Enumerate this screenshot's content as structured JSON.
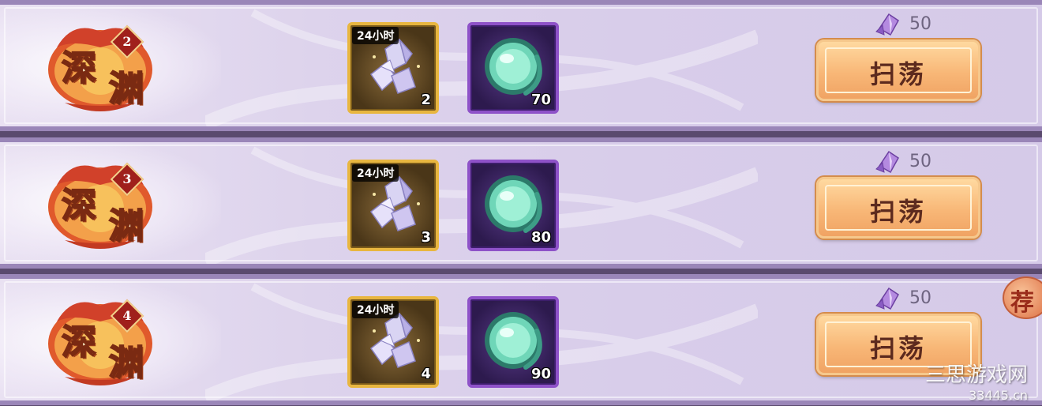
{
  "rows": [
    {
      "emblem": {
        "chars": [
          "深",
          "渊"
        ],
        "level": "2"
      },
      "rewards": [
        {
          "icon": "crystal-cluster-icon",
          "tag": "24小时",
          "count": "2",
          "rarity": "gold"
        },
        {
          "icon": "jade-orb-icon",
          "count": "70",
          "rarity": "purple"
        }
      ],
      "cost": {
        "icon": "purple-crystal-icon",
        "value": "50"
      },
      "sweep_label": "扫荡"
    },
    {
      "emblem": {
        "chars": [
          "深",
          "渊"
        ],
        "level": "3"
      },
      "rewards": [
        {
          "icon": "crystal-cluster-icon",
          "tag": "24小时",
          "count": "3",
          "rarity": "gold"
        },
        {
          "icon": "jade-orb-icon",
          "count": "80",
          "rarity": "purple"
        }
      ],
      "cost": {
        "icon": "purple-crystal-icon",
        "value": "50"
      },
      "sweep_label": "扫荡"
    },
    {
      "emblem": {
        "chars": [
          "深",
          "渊"
        ],
        "level": "4"
      },
      "rewards": [
        {
          "icon": "crystal-cluster-icon",
          "tag": "24小时",
          "count": "4",
          "rarity": "gold"
        },
        {
          "icon": "jade-orb-icon",
          "count": "90",
          "rarity": "purple"
        }
      ],
      "cost": {
        "icon": "purple-crystal-icon",
        "value": "50"
      },
      "sweep_label": "扫荡"
    }
  ],
  "recommend_badge": "荐",
  "watermark": {
    "line1": "三思游戏网",
    "line2": "33445.cn"
  },
  "colors": {
    "row_bg": "#ddd3ec",
    "row_border": "#9a86b8",
    "button": "#f8b777",
    "button_text": "#5c2a1e",
    "gold_frame": "#e8b640",
    "purple_frame": "#8e52c8"
  }
}
